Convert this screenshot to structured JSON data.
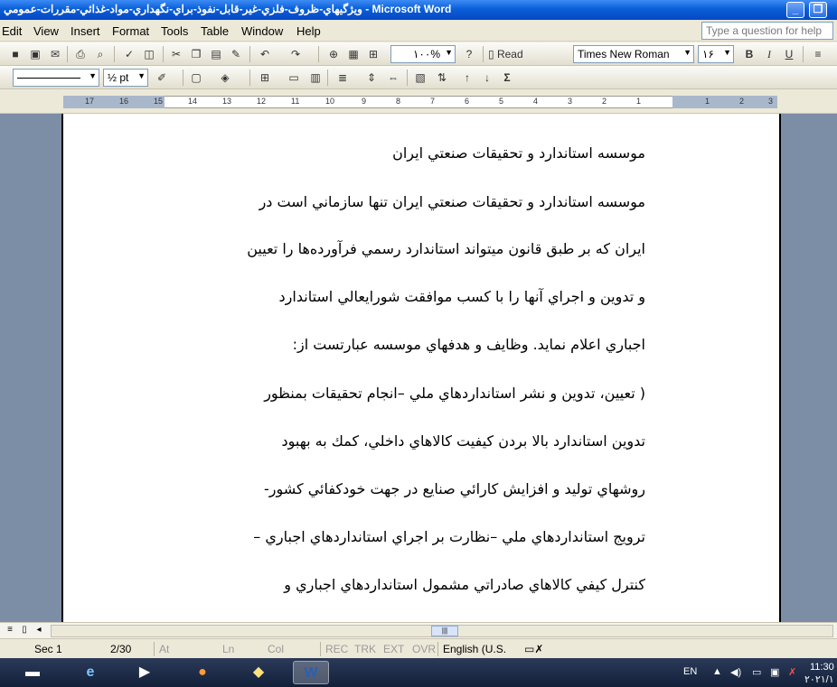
{
  "window": {
    "title": "ويژگيهاي-ظروف-فلزي-غير-قابل-نفوذ-براي-نگهداري-مواد-غذائي-مقررات-عمومي - Microsoft Word",
    "min_glyph": "_",
    "max_glyph": "❐"
  },
  "menu": {
    "items": [
      "Edit",
      "View",
      "Insert",
      "Format",
      "Tools",
      "Table",
      "Window",
      "Help"
    ],
    "help_placeholder": "Type a question for help"
  },
  "toolbar": {
    "zoom": "۱۰۰%",
    "read_label": "Read",
    "font_name": "Times New Roman",
    "font_size": "۱۶",
    "bold": "B",
    "italic": "I",
    "underline": "U",
    "line_weight": "½ pt",
    "sigma": "Σ"
  },
  "ruler": {
    "numbers": [
      "17",
      "16",
      "15",
      "14",
      "13",
      "12",
      "11",
      "10",
      "9",
      "8",
      "7",
      "6",
      "5",
      "4",
      "3",
      "2",
      "1",
      "1",
      "2",
      "3"
    ]
  },
  "document": {
    "lines": [
      "موسسه استاندارد و تحقيقات صنعتي ايران",
      "موسسه استاندارد و تحقيقات صنعتي ايران تنها سازماني است در",
      "ايران كه بر طبق قانون ميتواند استاندارد رسمي فرآورده‌ها را تعيين",
      "و تدوين و اجراي آنها را با كسب موافقت شورايعالي استاندارد",
      "اجباري اعلام نمايد. وظايف و هدفهاي موسسه عبارتست از:",
      "( تعيين، تدوين و نشر استانداردهاي ملي –انجام تحقيقات بمنظور",
      "تدوين استاندارد بالا بردن كيفيت كالاهاي داخلي، كمك به بهبود",
      "روشهاي توليد و افزايش كارائي صنايع در جهت خودكفائي كشور-",
      "ترويج استانداردهاي ملي –نظارت بر اجراي استانداردهاي اجباري –",
      "كنترل كيفي كالاهاي صادراتي مشمول استانداردهاي اجباري و"
    ]
  },
  "statusbar": {
    "sec": "Sec 1",
    "page": "2/30",
    "at": "At",
    "ln": "Ln",
    "col": "Col",
    "rec": "REC",
    "trk": "TRK",
    "ext": "EXT",
    "ovr": "OVR",
    "language": "English (U.S."
  },
  "taskbar": {
    "lang": "EN",
    "time": "11:30",
    "date": "۲۰۲۱/۱"
  },
  "colors": {
    "titlebar": "#0a5fd8",
    "doc_background": "#7c8da6",
    "page": "#ffffff"
  }
}
